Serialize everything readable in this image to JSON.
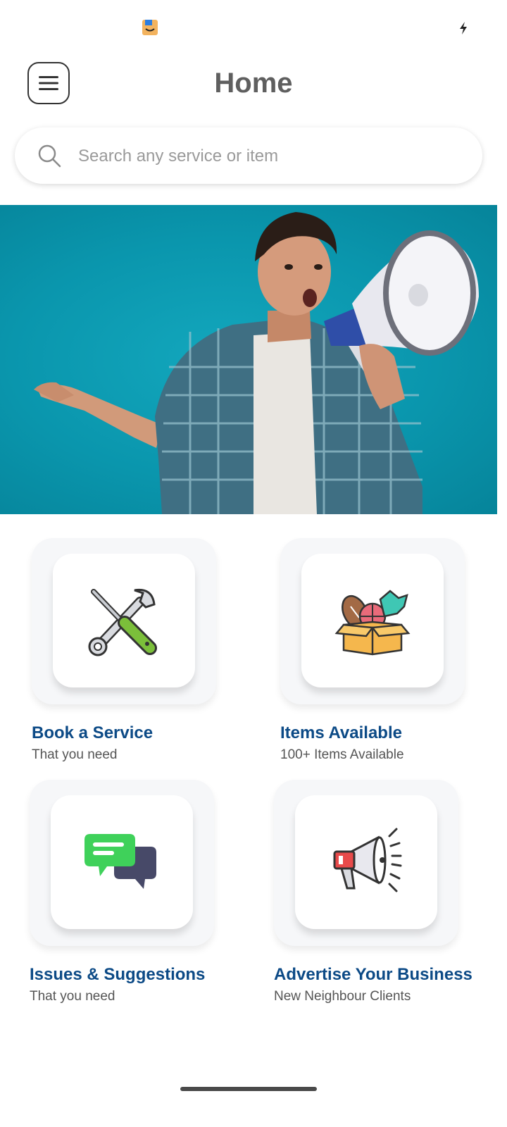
{
  "status_bar": {
    "app_icon": "amazon-app-icon",
    "battery_icon": "charging-bolt-icon"
  },
  "header": {
    "menu_icon": "hamburger-menu-icon",
    "title": "Home"
  },
  "search": {
    "placeholder": "Search any service or item",
    "icon": "search-icon"
  },
  "banner": {
    "image": "man-with-megaphone-photo"
  },
  "cards": [
    {
      "id": "book-service",
      "icon": "tools-icon",
      "title": "Book a Service",
      "subtitle": "That you need"
    },
    {
      "id": "items-available",
      "icon": "toy-box-icon",
      "title": "Items Available",
      "subtitle": "100+ Items Available"
    },
    {
      "id": "issues-suggestions",
      "icon": "chat-bubbles-icon",
      "title": "Issues & Suggestions",
      "subtitle": "That you need"
    },
    {
      "id": "advertise-business",
      "icon": "megaphone-icon",
      "title": "Advertise Your Business",
      "subtitle": "New Neighbour Clients"
    }
  ],
  "colors": {
    "title": "#5f5f5f",
    "card_title": "#0c4a86",
    "banner_bg": "#0a96ad"
  }
}
